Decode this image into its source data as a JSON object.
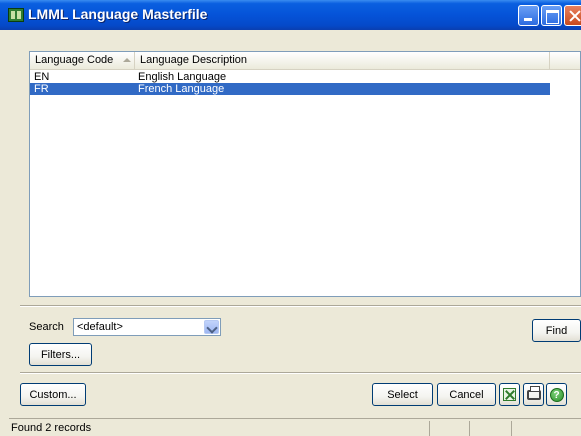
{
  "window": {
    "title": "LMML Language Masterfile"
  },
  "list": {
    "columns": [
      "Language Code",
      "Language Description"
    ],
    "rows": [
      {
        "code": "EN",
        "description": "English Language",
        "selected": false
      },
      {
        "code": "FR",
        "description": "French Language",
        "selected": true
      }
    ]
  },
  "search": {
    "label": "Search",
    "value": "<default>"
  },
  "buttons": {
    "find": "Find",
    "filters": "Filters...",
    "custom": "Custom...",
    "select": "Select",
    "cancel": "Cancel"
  },
  "status": {
    "text": "Found 2 records"
  },
  "icons": {
    "app": "lmml-app-icon",
    "excel": "excel-export-icon",
    "print": "printer-icon",
    "help": "help-icon"
  },
  "colors": {
    "selection": "#316ac5",
    "titlebar": "#0553d8",
    "window_bg": "#ece9d8"
  }
}
